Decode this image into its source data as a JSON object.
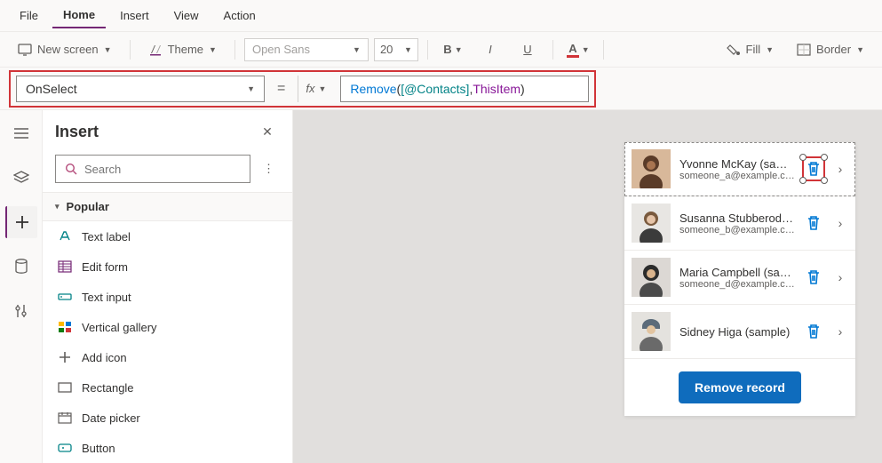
{
  "menubar": {
    "file": "File",
    "home": "Home",
    "insert": "Insert",
    "view": "View",
    "action": "Action"
  },
  "ribbon": {
    "newscreen": "New screen",
    "theme": "Theme",
    "font": "Open Sans",
    "size": "20",
    "bold": "B",
    "italic": "I",
    "underline": "U",
    "fontcolor": "A",
    "fill": "Fill",
    "border": "Border"
  },
  "formula": {
    "property": "OnSelect",
    "fn": "Remove",
    "lp": "( ",
    "ds": "[@Contacts]",
    "comma": ", ",
    "item": "ThisItem",
    "rp": " )"
  },
  "insert_panel": {
    "title": "Insert",
    "search_placeholder": "Search",
    "category": "Popular",
    "items": [
      "Text label",
      "Edit form",
      "Text input",
      "Vertical gallery",
      "Add icon",
      "Rectangle",
      "Date picker",
      "Button"
    ]
  },
  "gallery": {
    "rows": [
      {
        "name": "Yvonne McKay (sample)",
        "email": "someone_a@example.com"
      },
      {
        "name": "Susanna Stubberod (sample)",
        "email": "someone_b@example.com"
      },
      {
        "name": "Maria Campbell (sample)",
        "email": "someone_d@example.com"
      },
      {
        "name": "Sidney Higa (sample)",
        "email": ""
      }
    ],
    "button": "Remove record"
  }
}
